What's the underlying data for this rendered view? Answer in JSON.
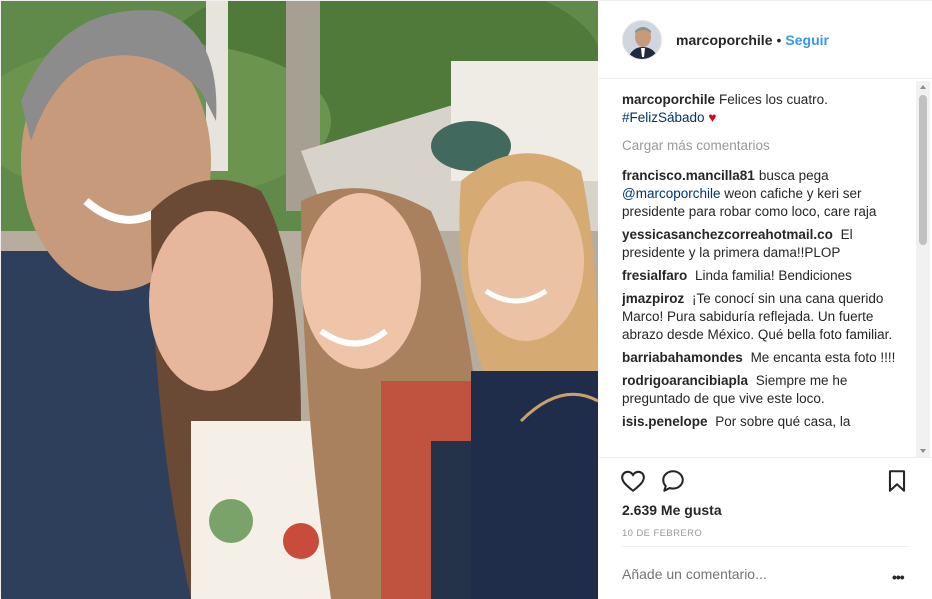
{
  "post": {
    "author": "marcoporchile",
    "separator": "•",
    "follow_label": "Seguir",
    "caption": {
      "username": "marcoporchile",
      "text": "Felices los cuatro.",
      "hashtag": "#FelizSábado",
      "emoji": "♥"
    },
    "load_more_label": "Cargar más comentarios",
    "comments": [
      {
        "username": "francisco.mancilla81",
        "pre": "busca pega ",
        "mention": "@marcoporchile",
        "post": " weon cafiche y keri ser presidente para robar como loco, care raja"
      },
      {
        "username": "yessicasanchezcorreahotmail.co",
        "pre": "El presidente y la primera dama!!PLOP",
        "mention": "",
        "post": ""
      },
      {
        "username": "fresialfaro",
        "pre": "Linda familia! Bendiciones",
        "mention": "",
        "post": ""
      },
      {
        "username": "jmazpiroz",
        "pre": "¡Te conocí sin una cana querido Marco! Pura sabiduría reflejada. Un fuerte abrazo desde México. Qué bella foto familiar.",
        "mention": "",
        "post": ""
      },
      {
        "username": "barriabahamondes",
        "pre": "Me encanta esta foto !!!!",
        "mention": "",
        "post": ""
      },
      {
        "username": "rodrigoarancibiapla",
        "pre": "Siempre me he preguntado de que vive este loco.",
        "mention": "",
        "post": ""
      },
      {
        "username": "isis.penelope",
        "pre": "Por sobre qué casa, la",
        "mention": "",
        "post": ""
      }
    ],
    "likes": "2.639 Me gusta",
    "date": "10 DE FEBRERO",
    "add_comment_placeholder": "Añade un comentario...",
    "more_options": "•••",
    "icons": {
      "like": "heart-outline-icon",
      "comment": "speech-bubble-icon",
      "save": "bookmark-icon",
      "more": "ellipsis-icon"
    },
    "colors": {
      "link_blue": "#3897f0",
      "hashtag": "#003569",
      "heart_red": "#d3061b",
      "muted": "#999999"
    }
  }
}
